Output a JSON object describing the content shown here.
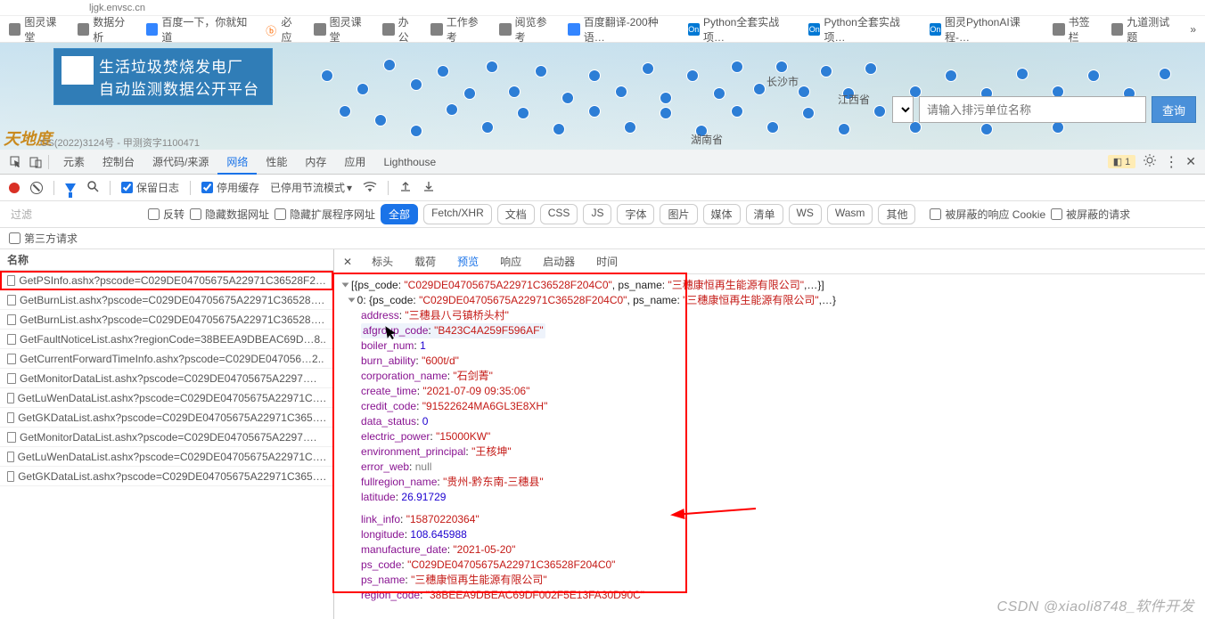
{
  "browser": {
    "url_fragment": "ljgk.envsc.cn"
  },
  "bookmarks": [
    {
      "label": "图灵课堂",
      "kind": "folder"
    },
    {
      "label": "数据分析",
      "kind": "folder"
    },
    {
      "label": "百度一下，你就知道",
      "kind": "baidu"
    },
    {
      "label": "必应",
      "kind": "fire"
    },
    {
      "label": "图灵课堂",
      "kind": "folder"
    },
    {
      "label": "办公",
      "kind": "folder"
    },
    {
      "label": "工作参考",
      "kind": "folder"
    },
    {
      "label": "阅览参考",
      "kind": "folder"
    },
    {
      "label": "百度翻译-200种语…",
      "kind": "baidu-trans"
    },
    {
      "label": "Python全套实战项…",
      "kind": "on"
    },
    {
      "label": "Python全套实战项…",
      "kind": "on"
    },
    {
      "label": "图灵PythonAI课程-…",
      "kind": "on"
    },
    {
      "label": "书签栏",
      "kind": "folder"
    },
    {
      "label": "九道测试题",
      "kind": "folder"
    }
  ],
  "banner": {
    "line1": "生活垃圾焚烧发电厂",
    "line2": "自动监测数据公开平台",
    "search_placeholder": "请输入排污单位名称",
    "search_btn": "查询",
    "city_labels": [
      "长沙市",
      "湖南省",
      "江西省"
    ],
    "copyright": "GS(2022)3124号 - 甲测资字1100471"
  },
  "devtools_tabs": [
    "元素",
    "控制台",
    "源代码/来源",
    "网络",
    "性能",
    "内存",
    "应用",
    "Lighthouse"
  ],
  "devtools_active": "网络",
  "warn_count": "1",
  "filter_bar": {
    "keep_log": "保留日志",
    "disable_cache": "停用缓存",
    "throttle": "已停用节流模式"
  },
  "req_types": {
    "filter_placeholder": "过滤",
    "invert": "反转",
    "hide_data_url": "隐藏数据网址",
    "hide_ext_url": "隐藏扩展程序网址",
    "chips": [
      "全部",
      "Fetch/XHR",
      "文档",
      "CSS",
      "JS",
      "字体",
      "图片",
      "媒体",
      "清单",
      "WS",
      "Wasm",
      "其他"
    ],
    "active": "全部",
    "blocked_cookie": "被屏蔽的响应 Cookie",
    "blocked_req": "被屏蔽的请求"
  },
  "third_party": "第三方请求",
  "req_list": {
    "header": "名称",
    "items": [
      "GetPSInfo.ashx?pscode=C029DE04705675A22971C36528F2…",
      "GetBurnList.ashx?pscode=C029DE04705675A22971C36528….",
      "GetBurnList.ashx?pscode=C029DE04705675A22971C36528….",
      "GetFaultNoticeList.ashx?regionCode=38BEEA9DBEAC69D…8..",
      "GetCurrentForwardTimeInfo.ashx?pscode=C029DE047056…2..",
      "GetMonitorDataList.ashx?pscode=C029DE04705675A2297….",
      "GetLuWenDataList.ashx?pscode=C029DE04705675A22971C….",
      "GetGKDataList.ashx?pscode=C029DE04705675A22971C365….",
      "GetMonitorDataList.ashx?pscode=C029DE04705675A2297….",
      "GetLuWenDataList.ashx?pscode=C029DE04705675A22971C….",
      "GetGKDataList.ashx?pscode=C029DE04705675A22971C365…."
    ],
    "selected": 0
  },
  "detail_tabs": [
    "标头",
    "载荷",
    "预览",
    "响应",
    "启动器",
    "时间"
  ],
  "detail_active": "预览",
  "json": {
    "array_head": "[{ps_code: \"C029DE04705675A22971C36528F204C0\", ps_name: \"三穗康恒再生能源有限公司\",…}]",
    "obj_head": "0: {ps_code: \"C029DE04705675A22971C36528F204C0\", ps_name: \"三穗康恒再生能源有限公司\",…}",
    "fields": [
      {
        "k": "address",
        "v": "\"三穗县八弓镇桥头村\"",
        "t": "s"
      },
      {
        "k": "afgroup_code",
        "v": "\"B423C4A259F596AF\"",
        "t": "s",
        "hl": true
      },
      {
        "k": "boiler_num",
        "v": "1",
        "t": "n"
      },
      {
        "k": "burn_ability",
        "v": "\"600t/d\"",
        "t": "s"
      },
      {
        "k": "corporation_name",
        "v": "\"石剑菁\"",
        "t": "s"
      },
      {
        "k": "create_time",
        "v": "\"2021-07-09 09:35:06\"",
        "t": "s"
      },
      {
        "k": "credit_code",
        "v": "\"91522624MA6GL3E8XH\"",
        "t": "s"
      },
      {
        "k": "data_status",
        "v": "0",
        "t": "n"
      },
      {
        "k": "electric_power",
        "v": "\"15000KW\"",
        "t": "s"
      },
      {
        "k": "environment_principal",
        "v": "\"王核坤\"",
        "t": "s"
      },
      {
        "k": "error_web",
        "v": "null",
        "t": "nl"
      },
      {
        "k": "fullregion_name",
        "v": "\"贵州-黔东南-三穗县\"",
        "t": "s"
      },
      {
        "k": "latitude",
        "v": "26.91729",
        "t": "n"
      },
      {
        "k": "link_info",
        "v": "\"15870220364\"",
        "t": "s",
        "arrow": true
      },
      {
        "k": "longitude",
        "v": "108.645988",
        "t": "n"
      },
      {
        "k": "manufacture_date",
        "v": "\"2021-05-20\"",
        "t": "s"
      },
      {
        "k": "ps_code",
        "v": "\"C029DE04705675A22971C36528F204C0\"",
        "t": "s"
      },
      {
        "k": "ps_name",
        "v": "\"三穗康恒再生能源有限公司\"",
        "t": "s"
      },
      {
        "k": "region_code",
        "v": "\"38BEEA9DBEAC69DF002F5E13FA30D90C\"",
        "t": "s"
      }
    ]
  },
  "watermark": "CSDN @xiaoli8748_软件开发"
}
